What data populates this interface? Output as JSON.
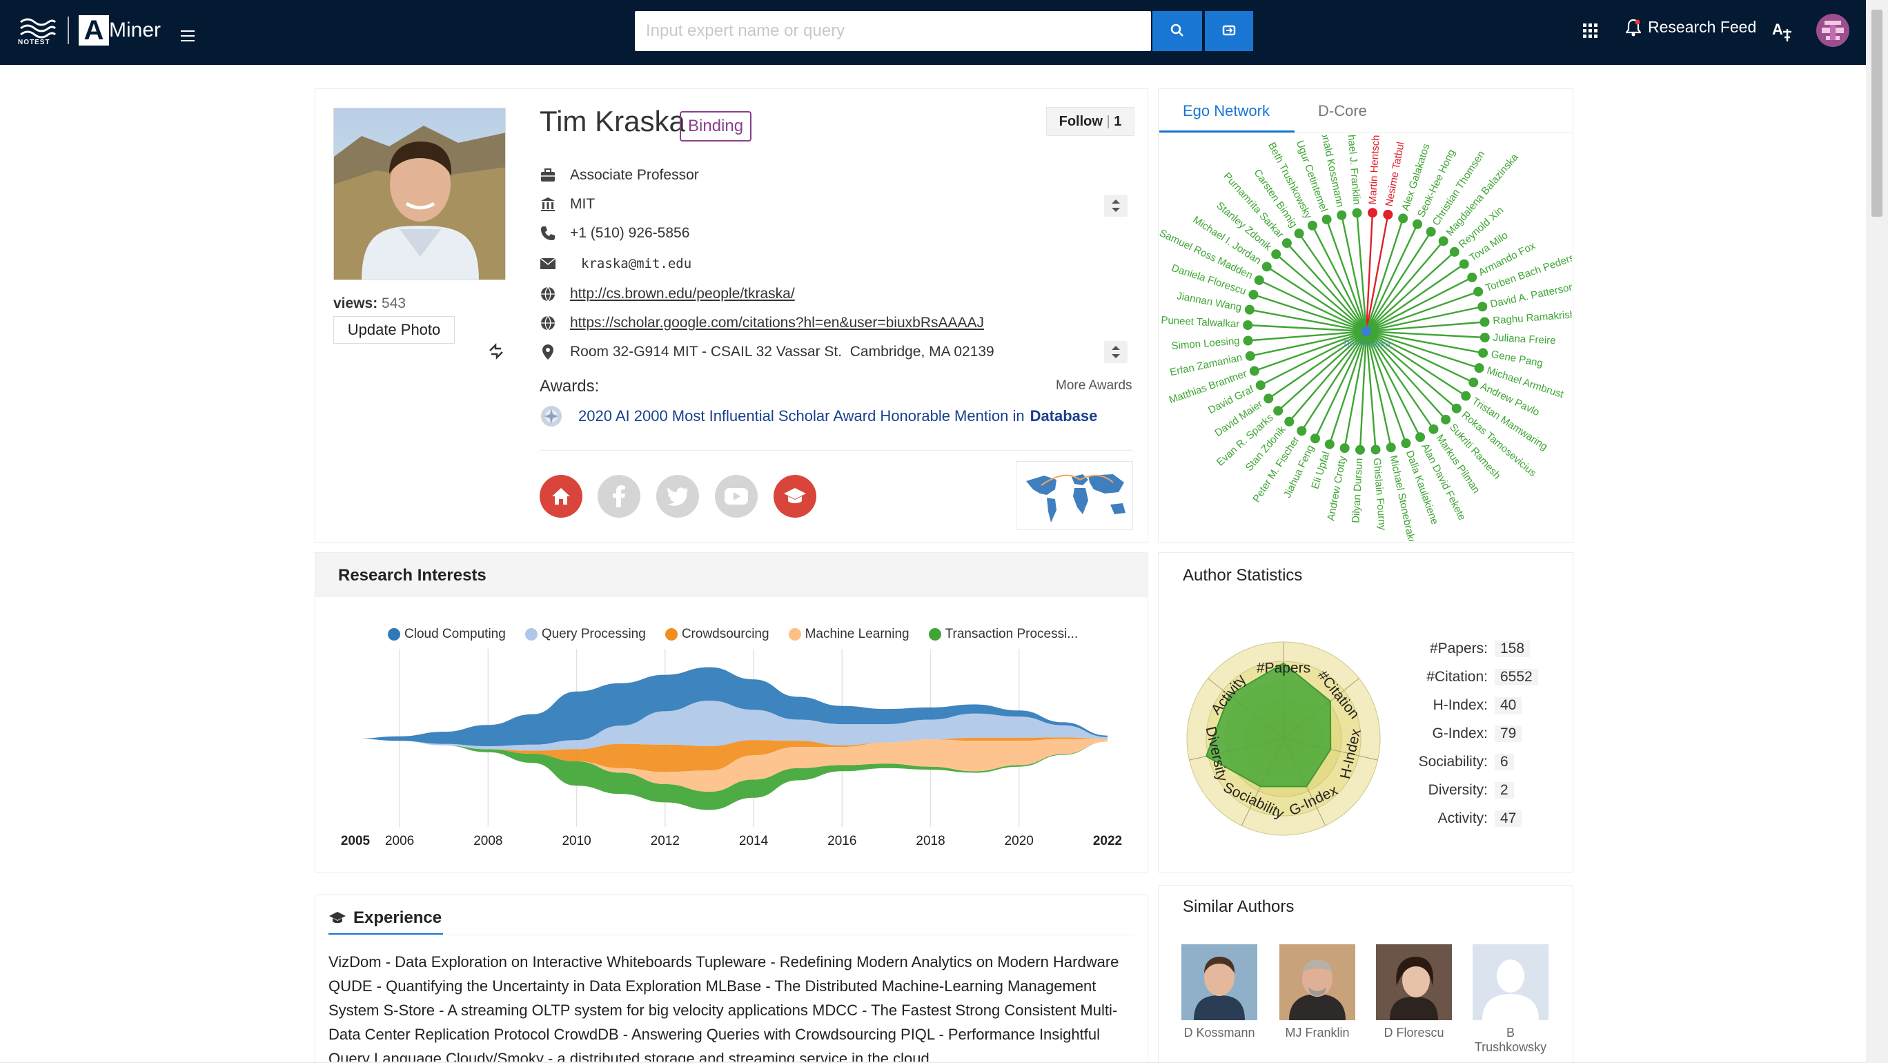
{
  "topbar": {
    "logo_left_text": "NOTEST",
    "brand_name": "Miner",
    "search_placeholder": "Input expert name or query",
    "research_feed_label": "Research Feed",
    "colors": {
      "bar": "#041a33",
      "accent": "#1976d2"
    },
    "icons": [
      "search-icon",
      "switch-icon",
      "apps-grid-icon",
      "bell-icon",
      "translate-icon",
      "avatar"
    ]
  },
  "profile": {
    "name": "Tim Kraska",
    "binding_label": "Binding",
    "follow_label": "Follow",
    "follow_count": "1",
    "views_label": "views:",
    "views_count": "543",
    "update_photo_label": "Update Photo",
    "position": "Associate Professor",
    "affiliation": "MIT",
    "phone": "+1 (510) 926-5856",
    "email": "kraska@mit.edu",
    "homepage": "http://cs.brown.edu/people/tkraska/",
    "scholar": "https://scholar.google.com/citations?hl=en&user=biuxbRsAAAAJ",
    "address": "Room 32-G914 MIT - CSAIL 32 Vassar St.  Cambridge, MA 02139",
    "awards_label": "Awards:",
    "more_awards_label": "More Awards",
    "award_text": "2020 AI 2000 Most Influential Scholar Award Honorable Mention in",
    "award_field": "Database"
  },
  "ego": {
    "tabs": [
      "Ego Network",
      "D-Core"
    ],
    "active_tab": "Ego Network",
    "center_label": "Tim Kraska",
    "names": [
      "Martin Hentsch",
      "Nesime Tatbul",
      "Alex Galakatos",
      "Seok-Hee Hong",
      "Christian Thomsen",
      "Magdalena Balazinska",
      "Reynold Xin",
      "Tova Milo",
      "Armando Fox",
      "Torben Bach Pedersen",
      "David A. Patterson",
      "Raghu Ramakrishnan",
      "Juliana Freire",
      "Gene Pang",
      "Michael Armbrust",
      "Andrew Pavlo",
      "Tristan Mamwaring",
      "Rokas Tamosevicius",
      "Sukriti Ramesh",
      "Markus Pilman",
      "Alan David Fekete",
      "Dalia Kaulakiene",
      "Michael Stonebraker",
      "Ghislain Fourny",
      "Dilyan Dursun",
      "Andrew Crotty",
      "Eli Upfal",
      "Jiahua Feng",
      "Peter M. Fischer",
      "Stan Zdonik",
      "Evan R. Sparks",
      "David Maier",
      "David Graf",
      "Matthias Brantner",
      "Erfan Zamanian",
      "Simon Loesing",
      "Puneet Talwalkar",
      "Jiannan Wang",
      "Daniela Florescu",
      "Samuel Ross Madden",
      "Michael I. Jordan",
      "Stanley Zdonik",
      "Purnamrita Sarkar",
      "Carsten Binnig",
      "Beth Trushkowsky",
      "Ugur Cetintemel",
      "Donald Kossmann",
      "Michael J. Franklin"
    ],
    "highlighted": [
      "Martin Hentsch",
      "Nesime Tatbul"
    ],
    "colors": {
      "node": "#3fa535",
      "highlight": "#e0202a",
      "center": "#3b7dd8"
    }
  },
  "research_interests": {
    "title": "Research Interests"
  },
  "chart_data": {
    "type": "area",
    "subtype": "streamgraph",
    "x": [
      2005,
      2006,
      2007,
      2008,
      2009,
      2010,
      2011,
      2012,
      2013,
      2014,
      2015,
      2016,
      2017,
      2018,
      2019,
      2020,
      2021,
      2022
    ],
    "x_tick_labels": [
      "2005",
      "2006",
      "2008",
      "2010",
      "2012",
      "2014",
      "2016",
      "2018",
      "2020",
      "2022"
    ],
    "series": [
      {
        "name": "Cloud Computing",
        "color": "#2e7ab8",
        "values": [
          0,
          0.3,
          0.8,
          1.4,
          2.0,
          3.2,
          2.8,
          2.4,
          2.2,
          2.0,
          1.5,
          1.2,
          1.0,
          0.8,
          0.6,
          0.4,
          0.2,
          0.1
        ]
      },
      {
        "name": "Query Processing",
        "color": "#aec7e8",
        "values": [
          0,
          0,
          0.1,
          0.2,
          0.4,
          0.6,
          1.2,
          2.2,
          3.0,
          2.0,
          1.4,
          1.4,
          1.2,
          1.3,
          1.6,
          1.4,
          0.8,
          0.1
        ]
      },
      {
        "name": "Crowdsourcing",
        "color": "#f28e1e",
        "values": [
          0,
          0,
          0,
          0,
          0.2,
          0.8,
          1.6,
          1.8,
          1.6,
          1.0,
          0.4,
          0.1,
          0,
          0,
          0.2,
          0.2,
          0.1,
          0
        ]
      },
      {
        "name": "Machine Learning",
        "color": "#fdbf85",
        "values": [
          0,
          0,
          0,
          0,
          0,
          0,
          0.3,
          0.8,
          1.4,
          1.6,
          1.4,
          1.2,
          1.4,
          1.8,
          2.0,
          1.6,
          1.0,
          0.2
        ]
      },
      {
        "name": "Transaction Processi...",
        "color": "#3fa535",
        "values": [
          0,
          0,
          0,
          0.2,
          0.6,
          1.6,
          1.4,
          1.2,
          1.2,
          1.2,
          0.8,
          0.4,
          0.3,
          0.2,
          0.1,
          0.1,
          0.05,
          0
        ]
      }
    ],
    "legend_position": "top",
    "grid": "vertical"
  },
  "author_stats": {
    "title": "Author Statistics",
    "radar_axes": [
      "#Papers",
      "#Citation",
      "H-Index",
      "G-Index",
      "Sociability",
      "Diversity",
      "Activity"
    ],
    "radar_levels": [
      0.78,
      0.62,
      0.5,
      0.55,
      0.55,
      0.82,
      0.72
    ],
    "rows": [
      {
        "label": "#Papers:",
        "value": "158"
      },
      {
        "label": "#Citation:",
        "value": "6552"
      },
      {
        "label": "H-Index:",
        "value": "40"
      },
      {
        "label": "G-Index:",
        "value": "79"
      },
      {
        "label": "Sociability:",
        "value": "6"
      },
      {
        "label": "Diversity:",
        "value": "2"
      },
      {
        "label": "Activity:",
        "value": "47"
      }
    ]
  },
  "experience": {
    "title": "Experience",
    "text": "VizDom - Data Exploration on Interactive Whiteboards Tupleware - Redefining Modern Analytics on Modern Hardware QUDE - Quantifying the Uncertainty in Data Exploration MLBase - The Distributed Machine-Learning Management System S-Store - A streaming OLTP system for big velocity applications MDCC - The Fastest Strong Consistent Multi-Data Center Replication Protocol CrowdDB - Answering Queries with Crowdsourcing PIQL - Performance Insightful Query Language Cloudy/Smoky - a distributed storage and streaming service in the cloud"
  },
  "similar_authors": {
    "title": "Similar Authors",
    "items": [
      {
        "name": "D Kossmann"
      },
      {
        "name": "MJ Franklin"
      },
      {
        "name": "D Florescu"
      },
      {
        "name": "B Trushkowsky"
      }
    ]
  }
}
